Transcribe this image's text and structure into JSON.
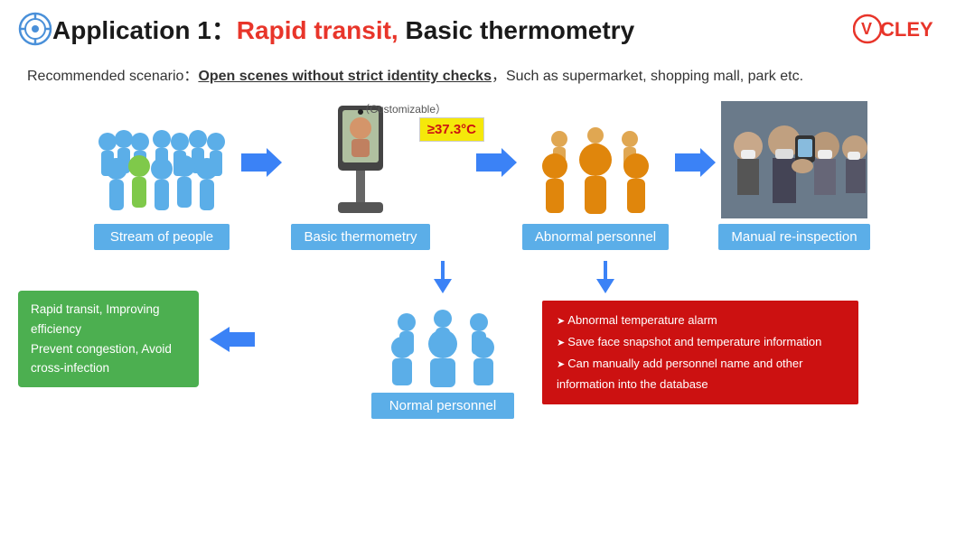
{
  "header": {
    "icon_alt": "compass-icon",
    "title_prefix": "Application 1：",
    "title_highlight": "Rapid transit,",
    "title_suffix": " Basic thermometry",
    "logo": "VCLEY"
  },
  "scenario": {
    "prefix": "Recommended scenario：",
    "underline_text": "Open scenes without strict identity checks",
    "suffix": "，Such as supermarket, shopping mall, park etc."
  },
  "flow": {
    "items": [
      {
        "label": "Stream of people"
      },
      {
        "label": "Basic thermometry"
      },
      {
        "label": "Abnormal personnel"
      },
      {
        "label": "Manual re-inspection"
      }
    ],
    "customizable": "（Customizable）",
    "temp_threshold": "≥37.3°C"
  },
  "bottom": {
    "green_box": {
      "line1": "Rapid transit, Improving efficiency",
      "line2": "Prevent congestion, Avoid cross-infection"
    },
    "normal_label": "Normal personnel",
    "red_box": {
      "items": [
        "Abnormal temperature alarm",
        "Save face snapshot and temperature information",
        "Can manually add personnel name and other information into the database"
      ]
    }
  },
  "colors": {
    "accent_blue": "#3b82f6",
    "label_blue": "#5baee8",
    "highlight_red": "#e8352a",
    "green": "#4caf50",
    "red_box": "#cc1111",
    "temp_yellow": "#f5e80a",
    "temp_red": "#cc0000"
  }
}
